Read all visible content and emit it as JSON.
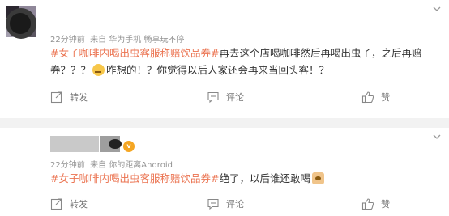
{
  "posts": [
    {
      "time": "22分钟前",
      "source_prefix": "来自",
      "source": "华为手机 畅享玩不停",
      "hashtag": "#女子咖啡内喝出虫客服称赔饮品券#",
      "text_line1": "再去这个店喝咖啡然后再喝出虫子，之后再赔",
      "text_line2a": "券？？？",
      "text_line2b": "咋想的！？你觉得以后人家还会再来当回头客！？",
      "emoji": "smirk-emoji",
      "actions": {
        "repost": "转发",
        "comment": "评论",
        "like": "赞"
      }
    },
    {
      "time": "22分钟前",
      "source_prefix": "来自",
      "source": "你的距离Android",
      "hashtag": "#女子咖啡内喝出虫客服称赔饮品券#",
      "text": "绝了，以后谁还敢喝",
      "emoji": "cat-emoji",
      "actions": {
        "repost": "转发",
        "comment": "评论",
        "like": "赞"
      }
    }
  ],
  "colors": {
    "accent": "#eb7350",
    "meta": "#939393",
    "separator": "#f2f2f2"
  }
}
